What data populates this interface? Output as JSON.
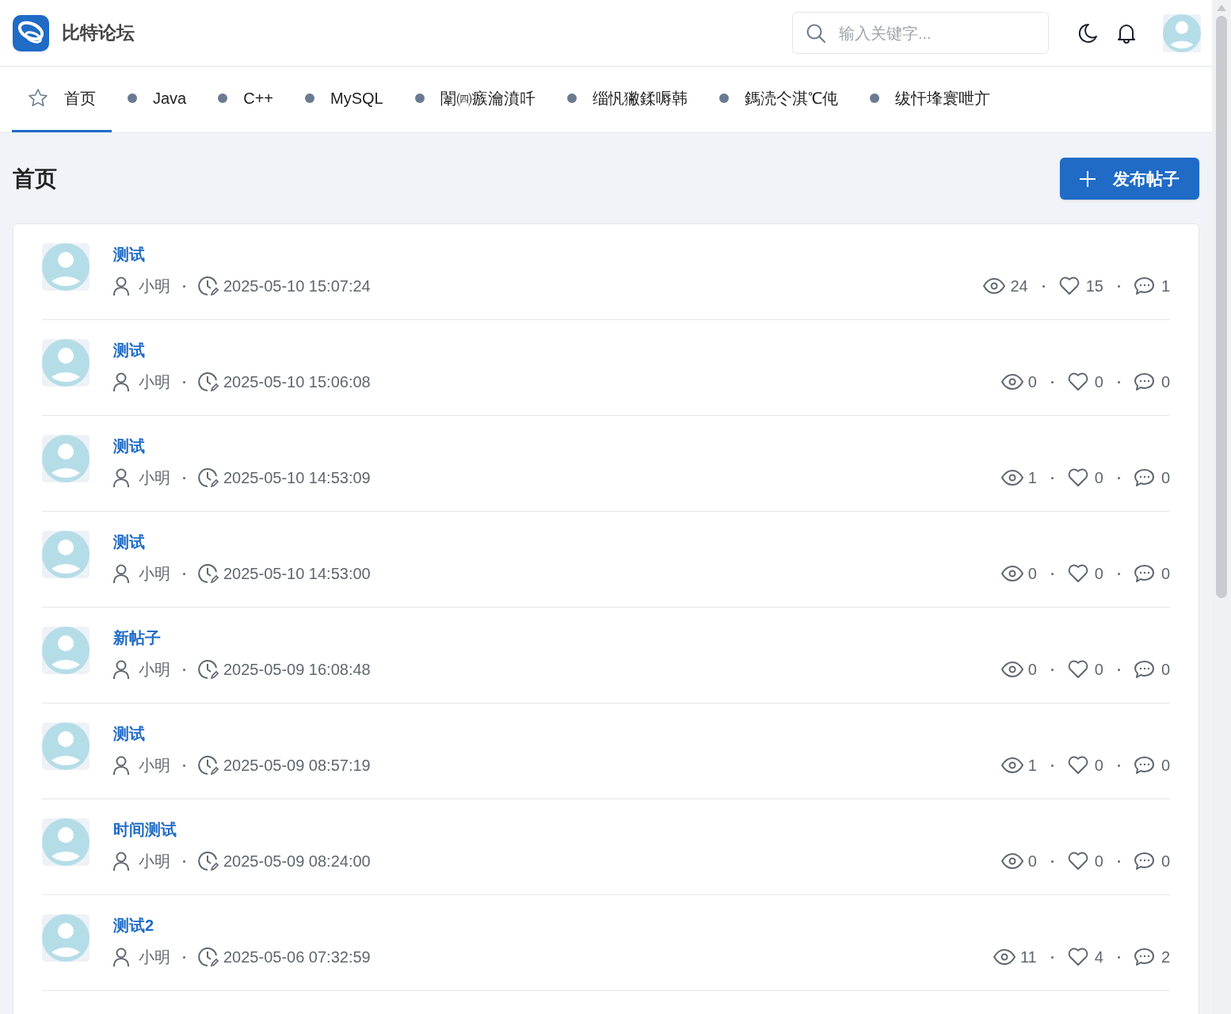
{
  "header": {
    "brand": "比特论坛",
    "search": {
      "placeholder": "输入关键字..."
    }
  },
  "tabs": [
    {
      "label": "首页",
      "kind": "home",
      "selected": true
    },
    {
      "label": "Java",
      "kind": "board",
      "selected": false
    },
    {
      "label": "C++",
      "kind": "board",
      "selected": false
    },
    {
      "label": "MySQL",
      "kind": "board",
      "selected": false
    },
    {
      "label": "闈㈣瘯瀹濆吀",
      "kind": "board",
      "selected": false
    },
    {
      "label": "缁忛獙鍒嗕韩",
      "kind": "board",
      "selected": false
    },
    {
      "label": "鎷涜仒淇℃伅",
      "kind": "board",
      "selected": false
    },
    {
      "label": "绂忓埄寰呭亣",
      "kind": "board",
      "selected": false
    }
  ],
  "page_title": "首页",
  "new_post_button": "发布帖子",
  "posts": [
    {
      "title": "测试",
      "author": "小明",
      "time": "2025-05-10 15:07:24",
      "views": "24",
      "likes": "15",
      "comments": "1"
    },
    {
      "title": "测试",
      "author": "小明",
      "time": "2025-05-10 15:06:08",
      "views": "0",
      "likes": "0",
      "comments": "0"
    },
    {
      "title": "测试",
      "author": "小明",
      "time": "2025-05-10 14:53:09",
      "views": "1",
      "likes": "0",
      "comments": "0"
    },
    {
      "title": "测试",
      "author": "小明",
      "time": "2025-05-10 14:53:00",
      "views": "0",
      "likes": "0",
      "comments": "0"
    },
    {
      "title": "新帖子",
      "author": "小明",
      "time": "2025-05-09 16:08:48",
      "views": "0",
      "likes": "0",
      "comments": "0"
    },
    {
      "title": "测试",
      "author": "小明",
      "time": "2025-05-09 08:57:19",
      "views": "1",
      "likes": "0",
      "comments": "0"
    },
    {
      "title": "时间测试",
      "author": "小明",
      "time": "2025-05-09 08:24:00",
      "views": "0",
      "likes": "0",
      "comments": "0"
    },
    {
      "title": "测试2",
      "author": "小明",
      "time": "2025-05-06 07:32:59",
      "views": "11",
      "likes": "4",
      "comments": "2"
    }
  ]
}
